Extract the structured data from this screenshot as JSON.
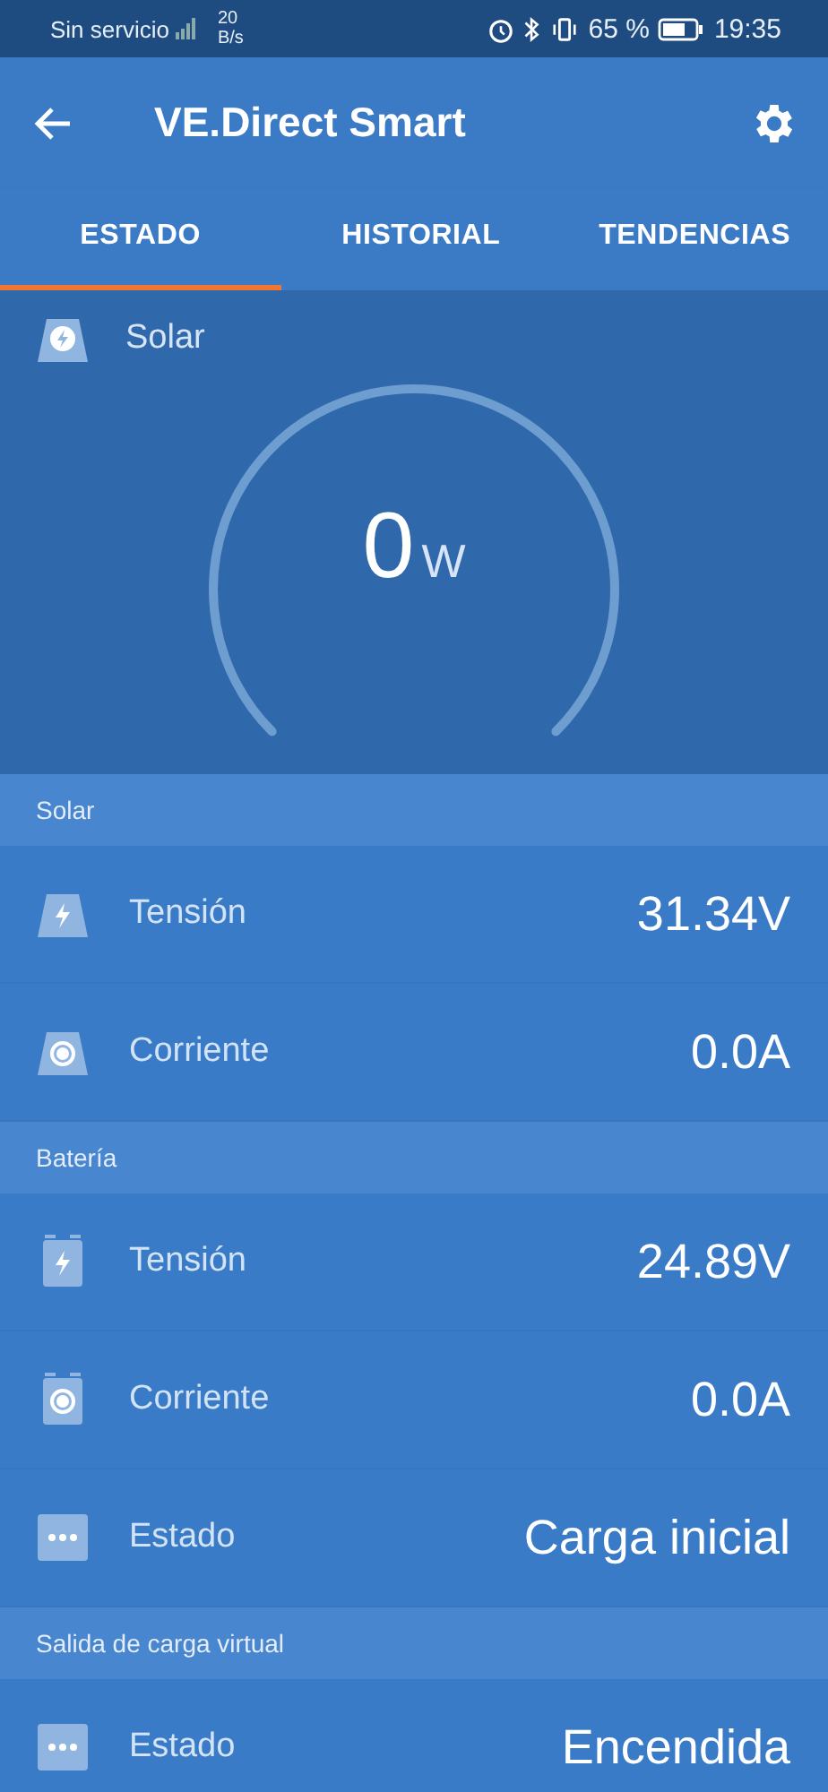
{
  "status_bar": {
    "carrier": "Sin servicio",
    "speed_value": "20",
    "speed_unit": "B/s",
    "battery": "65 %",
    "time": "19:35"
  },
  "app_bar": {
    "title": "VE.Direct Smart"
  },
  "tabs": [
    {
      "label": "ESTADO",
      "selected": true
    },
    {
      "label": "HISTORIAL",
      "selected": false
    },
    {
      "label": "TENDENCIAS",
      "selected": false
    }
  ],
  "gauge": {
    "label": "Solar",
    "value": "0",
    "unit": "W"
  },
  "sections": [
    {
      "title": "Solar",
      "kind": "solar",
      "rows": [
        {
          "label": "Tensión",
          "kind": "voltage",
          "value": "31.34V"
        },
        {
          "label": "Corriente",
          "kind": "current",
          "value": "0.0A"
        }
      ]
    },
    {
      "title": "Batería",
      "kind": "battery",
      "rows": [
        {
          "label": "Tensión",
          "kind": "voltage",
          "value": "24.89V"
        },
        {
          "label": "Corriente",
          "kind": "current",
          "value": "0.0A"
        },
        {
          "label": "Estado",
          "kind": "state",
          "value": "Carga inicial"
        }
      ]
    },
    {
      "title": "Salida de carga virtual",
      "kind": "virtual",
      "rows": [
        {
          "label": "Estado",
          "kind": "state",
          "value": "Encendida"
        }
      ]
    }
  ]
}
